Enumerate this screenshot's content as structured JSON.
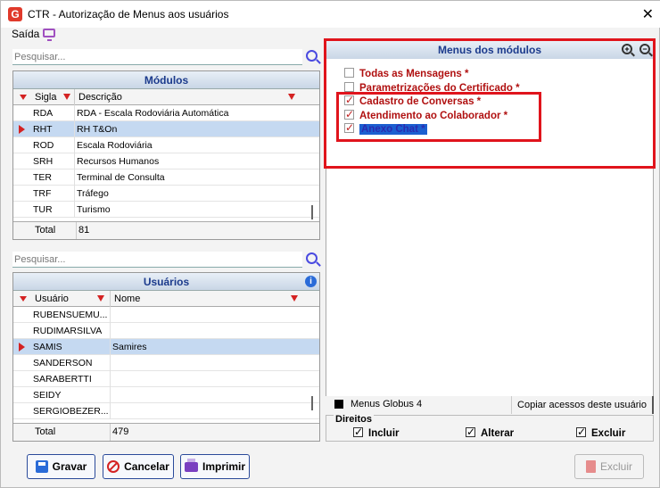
{
  "window": {
    "title": "CTR - Autorização de Menus aos usuários",
    "app_icon": "G"
  },
  "menubar": {
    "saida": "Saída"
  },
  "modulos": {
    "search_placeholder": "Pesquisar...",
    "title": "Módulos",
    "columns": [
      "Sigla",
      "Descrição"
    ],
    "rows": [
      {
        "sigla": "RDA",
        "descricao": "RDA - Escala Rodoviária Automática"
      },
      {
        "sigla": "RHT",
        "descricao": "RH T&On"
      },
      {
        "sigla": "ROD",
        "descricao": "Escala Rodoviária"
      },
      {
        "sigla": "SRH",
        "descricao": "Recursos Humanos"
      },
      {
        "sigla": "TER",
        "descricao": "Terminal de Consulta"
      },
      {
        "sigla": "TRF",
        "descricao": "Tráfego"
      },
      {
        "sigla": "TUR",
        "descricao": "Turismo"
      }
    ],
    "selected_index": 1,
    "total_label": "Total",
    "total_value": "81"
  },
  "usuarios": {
    "search_placeholder": "Pesquisar...",
    "title": "Usuários",
    "columns": [
      "Usuário",
      "Nome"
    ],
    "rows": [
      {
        "usuario": "RUBENSUEMU...",
        "nome": ""
      },
      {
        "usuario": "RUDIMARSILVA",
        "nome": ""
      },
      {
        "usuario": "SAMIS",
        "nome": "Samires"
      },
      {
        "usuario": "SANDERSON",
        "nome": ""
      },
      {
        "usuario": "SARABERTTI",
        "nome": ""
      },
      {
        "usuario": "SEIDY",
        "nome": ""
      },
      {
        "usuario": "SERGIOBEZER...",
        "nome": ""
      }
    ],
    "selected_index": 2,
    "total_label": "Total",
    "total_value": "479"
  },
  "menus": {
    "title": "Menus dos módulos",
    "items": [
      {
        "label": "Todas as Mensagens *",
        "checked": false
      },
      {
        "label": "Parametrizações do Certificado *",
        "checked": false
      },
      {
        "label": "Cadastro de Conversas *",
        "checked": true
      },
      {
        "label": "Atendimento ao Colaborador *",
        "checked": true
      },
      {
        "label": "Anexo Chat *",
        "checked": true
      }
    ]
  },
  "globus": {
    "label": "Menus Globus 4",
    "copy_button": "Copiar acessos deste usuário"
  },
  "direitos": {
    "title": "Direitos",
    "incluir": "Incluir",
    "alterar": "Alterar",
    "excluir": "Excluir"
  },
  "buttons": {
    "gravar": "Gravar",
    "cancelar": "Cancelar",
    "imprimir": "Imprimir",
    "excluir": "Excluir"
  },
  "colors": {
    "accent_red": "#e0141c",
    "header_blue": "#1b3a8c",
    "selection": "#c5d9f1"
  }
}
